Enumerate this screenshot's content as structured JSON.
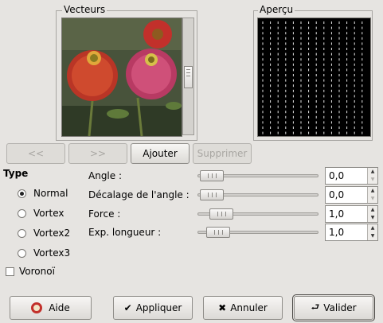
{
  "vectors_frame": {
    "title": "Vecteurs"
  },
  "preview_frame": {
    "title": "Aperçu"
  },
  "vector_buttons": {
    "prev": "<<",
    "next": ">>",
    "add": "Ajouter",
    "delete": "Supprimer"
  },
  "type_section": {
    "title": "Type",
    "options": [
      "Normal",
      "Vortex",
      "Vortex2",
      "Vortex3"
    ],
    "selected": "Normal",
    "voronoi_label": "Voronoï",
    "voronoi_checked": false
  },
  "params": [
    {
      "label": "Angle :",
      "value": "0,0",
      "level": 0.0
    },
    {
      "label": "Décalage de l'angle :",
      "value": "0,0",
      "level": 0.0
    },
    {
      "label": "Force :",
      "value": "1,0",
      "level": 0.1
    },
    {
      "label": "Exp. longueur :",
      "value": "1,0",
      "level": 0.07
    }
  ],
  "dialog_buttons": {
    "help": "Aide",
    "apply": "Appliquer",
    "cancel": "Annuler",
    "ok": "Valider"
  }
}
